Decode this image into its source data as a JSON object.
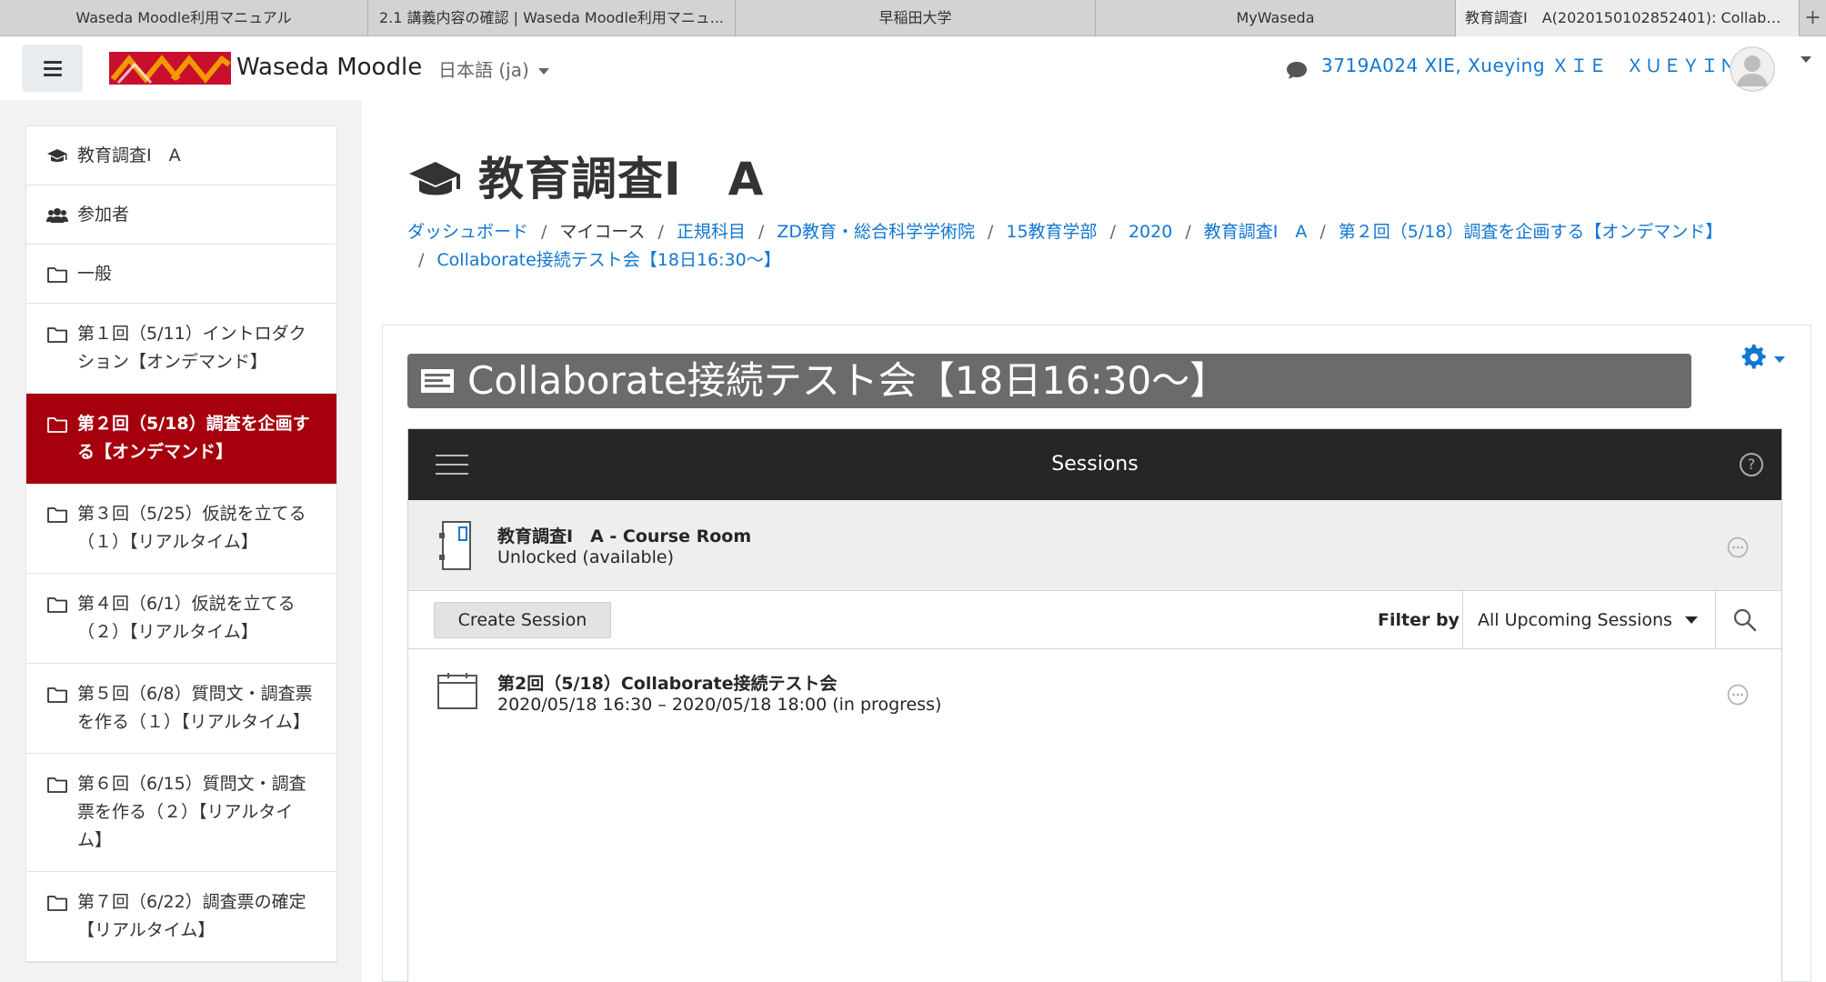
{
  "browser": {
    "tabs": [
      {
        "label": "Waseda Moodle利用マニュアル"
      },
      {
        "label": "2.1 講義内容の確認 | Waseda Moodle利用マニュ..."
      },
      {
        "label": "早稲田大学"
      },
      {
        "label": "MyWaseda"
      },
      {
        "label": "教育調査I　A(2020150102852401): Collabora..."
      }
    ],
    "new_tab_label": "+"
  },
  "navbar": {
    "site_name": "Waseda Moodle",
    "language": "日本語 (ja)",
    "user_name": "3719A024 XIE, Xueying ＸＩＥ　ＸＵＥＹＩＮＧ",
    "colors": {
      "link": "#1177d1",
      "logo_red": "#c8102e",
      "logo_orange": "#f39800"
    }
  },
  "drawer": {
    "items": [
      {
        "label": "教育調査I　A",
        "icon": "graduation-cap-icon"
      },
      {
        "label": "参加者",
        "icon": "users-icon"
      },
      {
        "label": "一般",
        "icon": "folder-icon"
      },
      {
        "label": "第１回（5/11）イントロダクション【オンデマンド】",
        "icon": "folder-icon"
      },
      {
        "label": "第２回（5/18）調査を企画する【オンデマンド】",
        "icon": "folder-icon",
        "active": true
      },
      {
        "label": "第３回（5/25）仮説を立てる（１）【リアルタイム】",
        "icon": "folder-icon"
      },
      {
        "label": "第４回（6/1）仮説を立てる（２）【リアルタイム】",
        "icon": "folder-icon"
      },
      {
        "label": "第５回（6/8）質問文・調査票を作る（１）【リアルタイム】",
        "icon": "folder-icon"
      },
      {
        "label": "第６回（6/15）質問文・調査票を作る（２）【リアルタイム】",
        "icon": "folder-icon"
      },
      {
        "label": "第７回（6/22）調査票の確定【リアルタイム】",
        "icon": "folder-icon"
      }
    ],
    "active_color": "#a6000d"
  },
  "page": {
    "title": "教育調査I　A",
    "breadcrumb": [
      "ダッシュボード",
      "マイコース",
      "正規科目",
      "ZD教育・総合科学学術院",
      "15教育学部",
      "2020",
      "教育調査I　A",
      "第２回（5/18）調査を企画する【オンデマンド】",
      "Collaborate接続テスト会【18日16:30〜】"
    ]
  },
  "activity": {
    "title": "Collaborate接続テスト会【18日16:30〜】",
    "header_bg": "#6b6b6b"
  },
  "collaborate": {
    "header_title": "Sessions",
    "help_label": "?",
    "course_room": {
      "name": "教育調査I　A - Course Room",
      "status": "Unlocked (available)"
    },
    "create_button": "Create Session",
    "filter_label": "Filter by",
    "filter_value": "All Upcoming Sessions",
    "sessions": [
      {
        "name": "第2回（5/18）Collaborate接続テスト会",
        "time": "2020/05/18 16:30 – 2020/05/18 18:00 (in progress)"
      }
    ]
  }
}
